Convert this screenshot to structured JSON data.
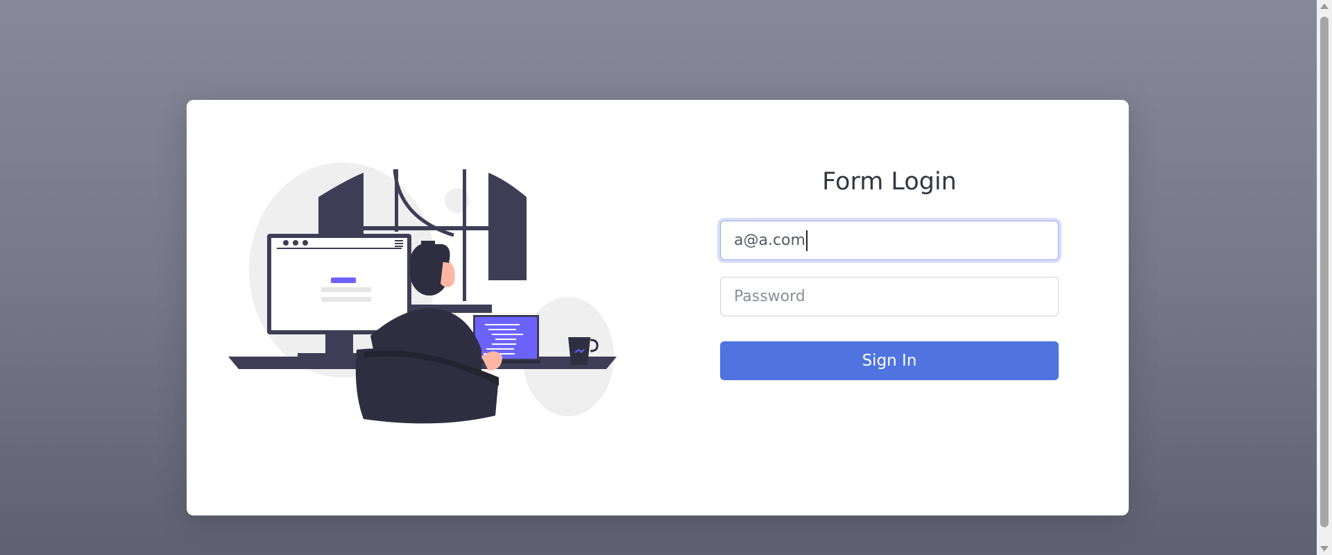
{
  "login": {
    "title": "Form Login",
    "email": {
      "value": "a@a.com"
    },
    "password": {
      "placeholder": "Password",
      "value": ""
    },
    "submit_label": "Sign In"
  },
  "colors": {
    "accent": "#4f74e0",
    "illustration_dark": "#3f3d56",
    "illustration_purple": "#6c63ff"
  },
  "icons": {
    "illustration": "developer-at-desk-illustration"
  }
}
